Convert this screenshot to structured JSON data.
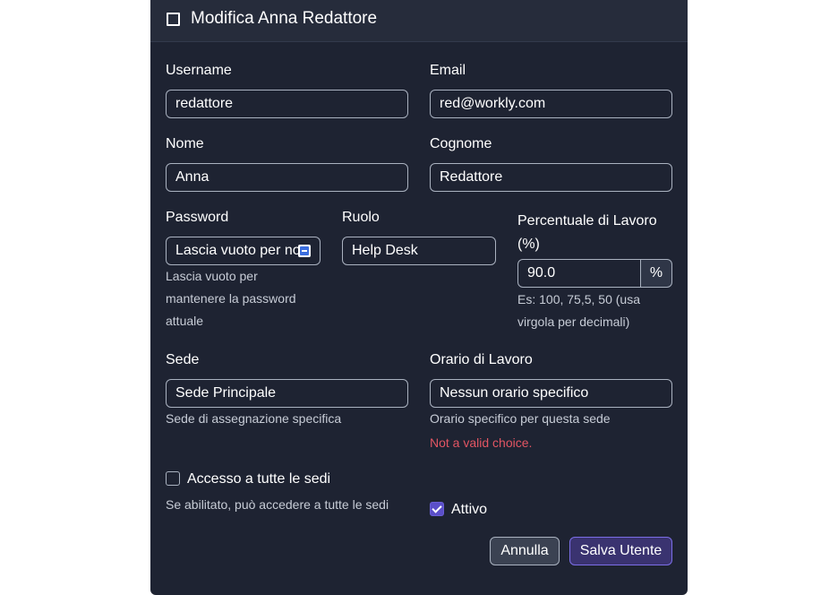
{
  "modal": {
    "title": "Modifica Anna Redattore",
    "header_icon": "square-icon"
  },
  "form": {
    "username": {
      "label": "Username",
      "value": "redattore"
    },
    "email": {
      "label": "Email",
      "value": "red@workly.com"
    },
    "nome": {
      "label": "Nome",
      "value": "Anna"
    },
    "cognome": {
      "label": "Cognome",
      "value": "Redattore"
    },
    "password": {
      "label": "Password",
      "placeholder": "Lascia vuoto per non modificare",
      "visible_text": "Lascia vuoto per no",
      "help_lines": [
        "Lascia vuoto per",
        "mantenere la password",
        "attuale"
      ],
      "icon": "password-manager-icon"
    },
    "ruolo": {
      "label": "Ruolo",
      "value": "Help Desk"
    },
    "percentuale": {
      "label_lines": [
        "Percentuale di Lavoro",
        "(%)"
      ],
      "value": "90.0",
      "addon": "%",
      "help_lines": [
        "Es: 100, 75,5, 50 (usa",
        "virgola per decimali)"
      ]
    },
    "sede": {
      "label": "Sede",
      "value": "Sede Principale",
      "help": "Sede di assegnazione specifica"
    },
    "orario": {
      "label": "Orario di Lavoro",
      "value": "Nessun orario specifico",
      "help": "Orario specifico per questa sede",
      "error": "Not a valid choice."
    },
    "accesso": {
      "label": "Accesso a tutte le sedi",
      "checked": false,
      "help": "Se abilitato, può accedere a tutte le sedi"
    },
    "attivo": {
      "label": "Attivo",
      "checked": true
    }
  },
  "buttons": {
    "cancel": "Annulla",
    "save": "Salva Utente"
  },
  "colors": {
    "background": "#1e2332",
    "header": "#262c3b",
    "accent": "#5b4fc9",
    "error": "#e25563"
  }
}
